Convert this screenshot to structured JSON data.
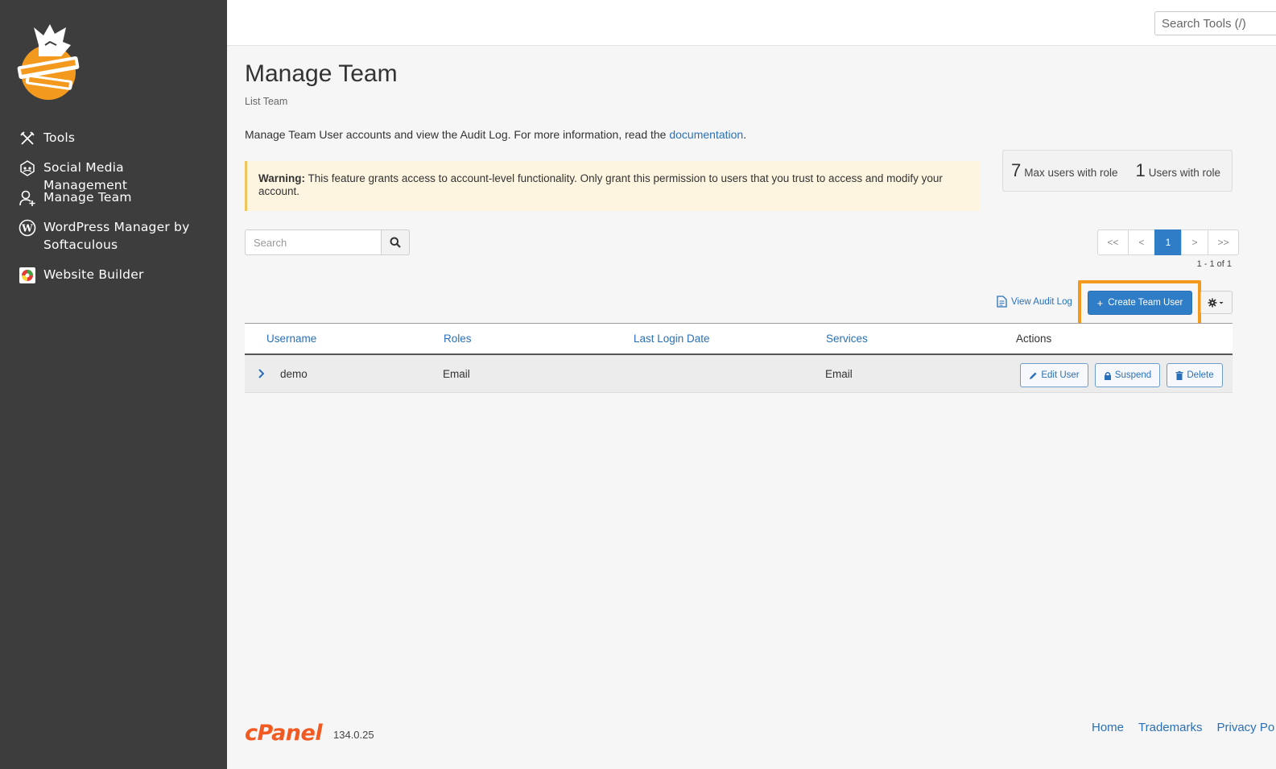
{
  "brand": {
    "logo_alt": "Grizzly Pumpkin",
    "accent": "#f39a1e",
    "primary": "#2f7cc7",
    "sidebar_bg": "#3d3d3d"
  },
  "sidebar": {
    "items": [
      {
        "label": "Tools",
        "icon": "tools-icon"
      },
      {
        "label": "Social Media Management",
        "icon": "social-media-icon"
      },
      {
        "label": "Manage Team",
        "icon": "manage-team-icon"
      },
      {
        "label": "WordPress Manager by Softaculous",
        "icon": "wordpress-icon"
      },
      {
        "label": "Website Builder",
        "icon": "website-builder-icon"
      }
    ]
  },
  "topbar": {
    "search_placeholder": "Search Tools (/)"
  },
  "page": {
    "title": "Manage Team",
    "subtitle": "List Team",
    "description_prefix": "Manage Team User accounts and view the Audit Log. For more information, read the ",
    "description_link": "documentation",
    "description_suffix": ".",
    "warning_label": "Warning:",
    "warning_text": " This feature grants access to account-level functionality. Only grant this permission to users that you trust to access and modify your account."
  },
  "stats": {
    "max_users": "7",
    "max_users_label": "Max users with role",
    "users_with_role": "1",
    "users_with_role_label": "Users with role"
  },
  "search": {
    "placeholder": "Search"
  },
  "pagination": {
    "first": "<<",
    "prev": "<",
    "current": "1",
    "next": ">",
    "last": ">>",
    "summary": "1 - 1 of 1"
  },
  "toolbar": {
    "audit_log_label": "View Audit Log",
    "create_label": "Create Team User"
  },
  "table": {
    "headers": [
      "Username",
      "Roles",
      "Last Login Date",
      "Services",
      "Actions"
    ],
    "rows": [
      {
        "username": "demo",
        "roles": "Email",
        "last_login": "",
        "services": "Email"
      }
    ],
    "actions": {
      "edit": "Edit User",
      "suspend": "Suspend",
      "delete": "Delete"
    }
  },
  "footer": {
    "logo_text": "cPanel",
    "version": "134.0.25",
    "links": [
      "Home",
      "Trademarks",
      "Privacy Po"
    ]
  }
}
